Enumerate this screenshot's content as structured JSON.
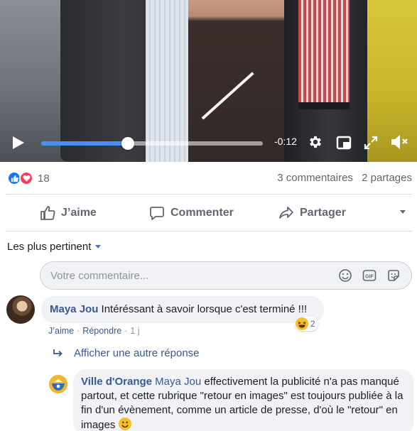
{
  "video": {
    "time_remaining": "-0:12",
    "progress_fraction": 0.39,
    "icons": [
      "play-icon",
      "gear-icon",
      "miniplayer-icon",
      "fullscreen-icon",
      "mute-icon"
    ]
  },
  "reactions": {
    "types": [
      "like",
      "love"
    ],
    "count": "18",
    "comments": "3 commentaires",
    "shares": "2 partages"
  },
  "actions": {
    "like": "J’aime",
    "comment": "Commenter",
    "share": "Partager"
  },
  "sort": {
    "label": "Les plus pertinent"
  },
  "composer": {
    "placeholder": "Votre commentaire..."
  },
  "comments": [
    {
      "author": "Maya Jou",
      "text": "Intéréssant à savoir lorsque c'est terminé !!!",
      "like": "J’aime",
      "reply": "Répondre",
      "age": "1 j",
      "reaction_count": "2",
      "more_replies": "Afficher une autre réponse"
    }
  ],
  "reply": {
    "author": "Ville d'Orange",
    "mention": "Maya Jou",
    "text": "effectivement la publicité n'a pas manqué partout, et cette rubrique \"retour en images\" est toujours publiée à la fin d'un évènement, comme un article de presse, d'où le \"retour\" en images"
  },
  "colors": {
    "accent": "#385898",
    "like_blue": "#1877f2",
    "love_red": "#f33e58",
    "progress": "#4b8ef0"
  }
}
